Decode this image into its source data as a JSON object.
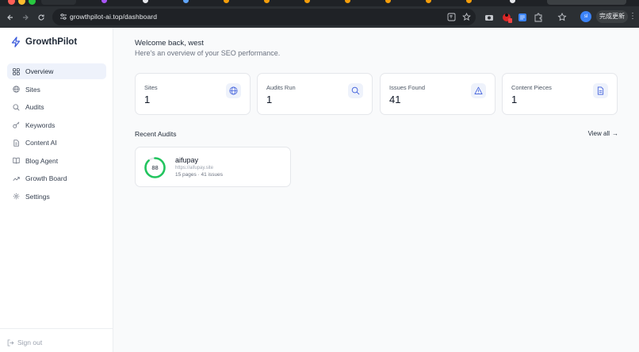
{
  "browser": {
    "url": "growthpilot-ai.top/dashboard",
    "update_label": "完成更新",
    "profile_initial": "sl"
  },
  "brand": {
    "name": "GrowthPilot",
    "accent": "#3b5bdb"
  },
  "sidebar": {
    "items": [
      {
        "label": "Overview",
        "icon": "grid-icon",
        "active": true
      },
      {
        "label": "Sites",
        "icon": "globe-icon"
      },
      {
        "label": "Audits",
        "icon": "search-icon"
      },
      {
        "label": "Keywords",
        "icon": "key-icon"
      },
      {
        "label": "Content AI",
        "icon": "document-icon"
      },
      {
        "label": "Blog Agent",
        "icon": "book-icon"
      },
      {
        "label": "Growth Board",
        "icon": "trend-icon"
      },
      {
        "label": "Settings",
        "icon": "gear-icon"
      }
    ],
    "signout": "Sign out"
  },
  "main": {
    "welcome": "Welcome back, west",
    "subtitle": "Here's an overview of your SEO performance.",
    "stats": [
      {
        "label": "Sites",
        "value": "1",
        "icon": "globe-icon"
      },
      {
        "label": "Audits Run",
        "value": "1",
        "icon": "search-icon"
      },
      {
        "label": "Issues Found",
        "value": "41",
        "icon": "warning-icon"
      },
      {
        "label": "Content Pieces",
        "value": "1",
        "icon": "document-icon"
      }
    ],
    "recent_title": "Recent Audits",
    "view_all": "View all",
    "audits": [
      {
        "name": "aifupay",
        "url": "https://aifupay.site",
        "meta": "15 pages · 41 issues",
        "score": "88",
        "score_fraction": 0.88,
        "score_color": "#22c55e"
      }
    ]
  }
}
